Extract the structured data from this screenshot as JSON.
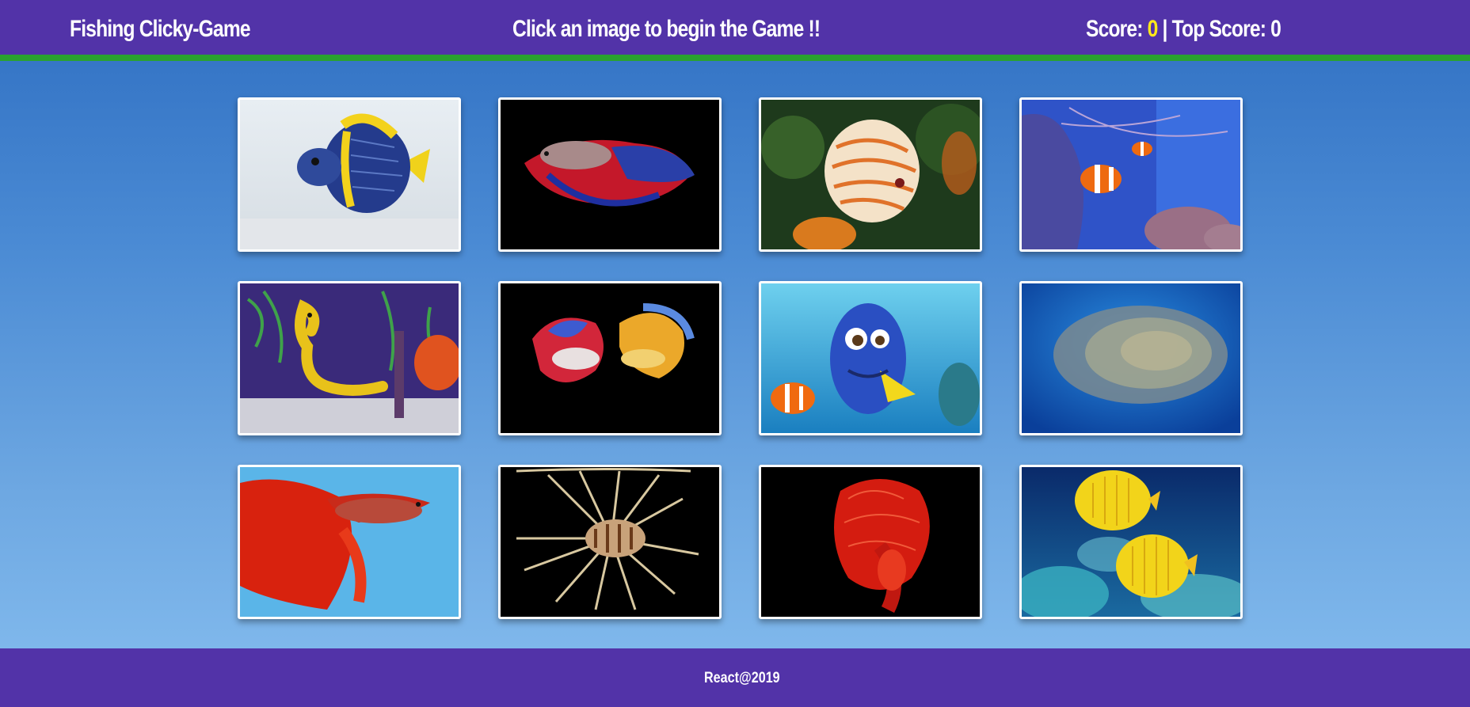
{
  "header": {
    "brand": "Fishing Clicky-Game",
    "message": "Click an image to begin the Game !!",
    "score_label": "Score: ",
    "score_value": "0",
    "separator": " | ",
    "top_score_label": "Top Score: ",
    "top_score_value": "0"
  },
  "colors": {
    "navbar": "#5233a8",
    "navbar_border": "#2aa12f",
    "score_highlight": "#ffe81a"
  },
  "cards": [
    {
      "name": "angelfish-card",
      "image": "blue and yellow angelfish on sand"
    },
    {
      "name": "betta-red-blue-card",
      "image": "red and blue betta fish on black"
    },
    {
      "name": "discus-card",
      "image": "orange patterned discus fish"
    },
    {
      "name": "clownfish-card",
      "image": "clownfish in coral reef"
    },
    {
      "name": "seahorse-card",
      "image": "yellow seahorse among plants"
    },
    {
      "name": "betta-pair-card",
      "image": "two betta fish on black"
    },
    {
      "name": "dory-nemo-card",
      "image": "blue tang and clownfish cartoon"
    },
    {
      "name": "fish-school-card",
      "image": "school of sardines in blue water"
    },
    {
      "name": "betta-red-card",
      "image": "red betta fish on light blue"
    },
    {
      "name": "lionfish-card",
      "image": "lionfish on black"
    },
    {
      "name": "betta-crimson-card",
      "image": "crimson betta fish on black"
    },
    {
      "name": "butterflyfish-card",
      "image": "yellow butterflyfish over reef"
    }
  ],
  "footer": {
    "text": "React@2019"
  }
}
